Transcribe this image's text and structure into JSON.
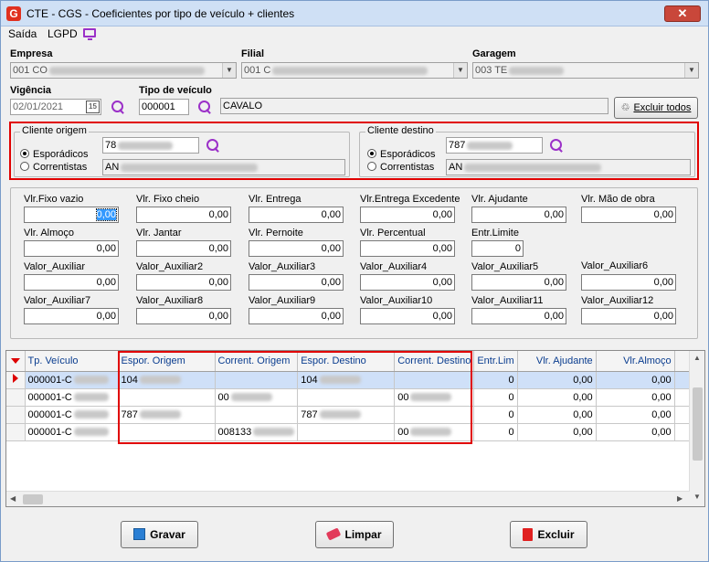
{
  "window": {
    "title": "CTE - CGS - Coeficientes por tipo de veículo + clientes",
    "close_label": "✕"
  },
  "menu": {
    "saida": "Saída",
    "lgpd": "LGPD"
  },
  "form": {
    "empresa_label": "Empresa",
    "empresa_value": "001 CO",
    "filial_label": "Filial",
    "filial_value": "001 C",
    "garagem_label": "Garagem",
    "garagem_value": "003 TE",
    "vigencia_label": "Vigência",
    "vigencia_value": "02/01/2021",
    "calendar_label": "15",
    "tipo_label": "Tipo de veículo",
    "tipo_code": "000001",
    "tipo_desc": "CAVALO",
    "excluir_todos": "Excluir todos"
  },
  "cliente_origem": {
    "title": "Cliente origem",
    "opt1": "Esporádicos",
    "opt2": "Correntistas",
    "code": "78",
    "name": "AN"
  },
  "cliente_destino": {
    "title": "Cliente destino",
    "opt1": "Esporádicos",
    "opt2": "Correntistas",
    "code": "787",
    "name": "AN"
  },
  "values": [
    {
      "label": "Vlr.Fixo vazio",
      "value": "0,00"
    },
    {
      "label": "Vlr. Fixo cheio",
      "value": "0,00"
    },
    {
      "label": "Vlr. Entrega",
      "value": "0,00"
    },
    {
      "label": "Vlr.Entrega Excedente",
      "value": "0,00"
    },
    {
      "label": "Vlr. Ajudante",
      "value": "0,00"
    },
    {
      "label": "Vlr. Mão de obra",
      "value": "0,00"
    },
    {
      "label": "Vlr. Almoço",
      "value": "0,00"
    },
    {
      "label": "Vlr. Jantar",
      "value": "0,00"
    },
    {
      "label": "Vlr. Pernoite",
      "value": "0,00"
    },
    {
      "label": "Vlr. Percentual",
      "value": "0,00"
    },
    {
      "label": "Entr.Limite",
      "value": "0"
    },
    {
      "label": "Valor_Auxiliar",
      "value": "0,00"
    },
    {
      "label": "Valor_Auxiliar2",
      "value": "0,00"
    },
    {
      "label": "Valor_Auxiliar3",
      "value": "0,00"
    },
    {
      "label": "Valor_Auxiliar4",
      "value": "0,00"
    },
    {
      "label": "Valor_Auxiliar5",
      "value": "0,00"
    },
    {
      "label": "Valor_Auxiliar6",
      "value": "0,00"
    },
    {
      "label": "Valor_Auxiliar7",
      "value": "0,00"
    },
    {
      "label": "Valor_Auxiliar8",
      "value": "0,00"
    },
    {
      "label": "Valor_Auxiliar9",
      "value": "0,00"
    },
    {
      "label": "Valor_Auxiliar10",
      "value": "0,00"
    },
    {
      "label": "Valor_Auxiliar11",
      "value": "0,00"
    },
    {
      "label": "Valor_Auxiliar12",
      "value": "0,00"
    }
  ],
  "grid": {
    "columns": [
      "Tp. Veículo",
      "Espor. Origem",
      "Corrent. Origem",
      "Espor. Destino",
      "Corrent. Destino",
      "Entr.Lim",
      "Vlr. Ajudante",
      "Vlr.Almoço"
    ],
    "rows": [
      [
        "000001-C",
        "104",
        "",
        "104",
        "",
        "0",
        "0,00",
        "0,00"
      ],
      [
        "000001-C",
        "",
        "00",
        "",
        "00",
        "0",
        "0,00",
        "0,00"
      ],
      [
        "000001-C",
        "787",
        "",
        "787",
        "",
        "0",
        "0,00",
        "0,00"
      ],
      [
        "000001-C",
        "",
        "008133",
        "",
        "00",
        "0",
        "0,00",
        "0,00"
      ]
    ]
  },
  "buttons": {
    "gravar": "Gravar",
    "limpar": "Limpar",
    "excluir": "Excluir"
  }
}
